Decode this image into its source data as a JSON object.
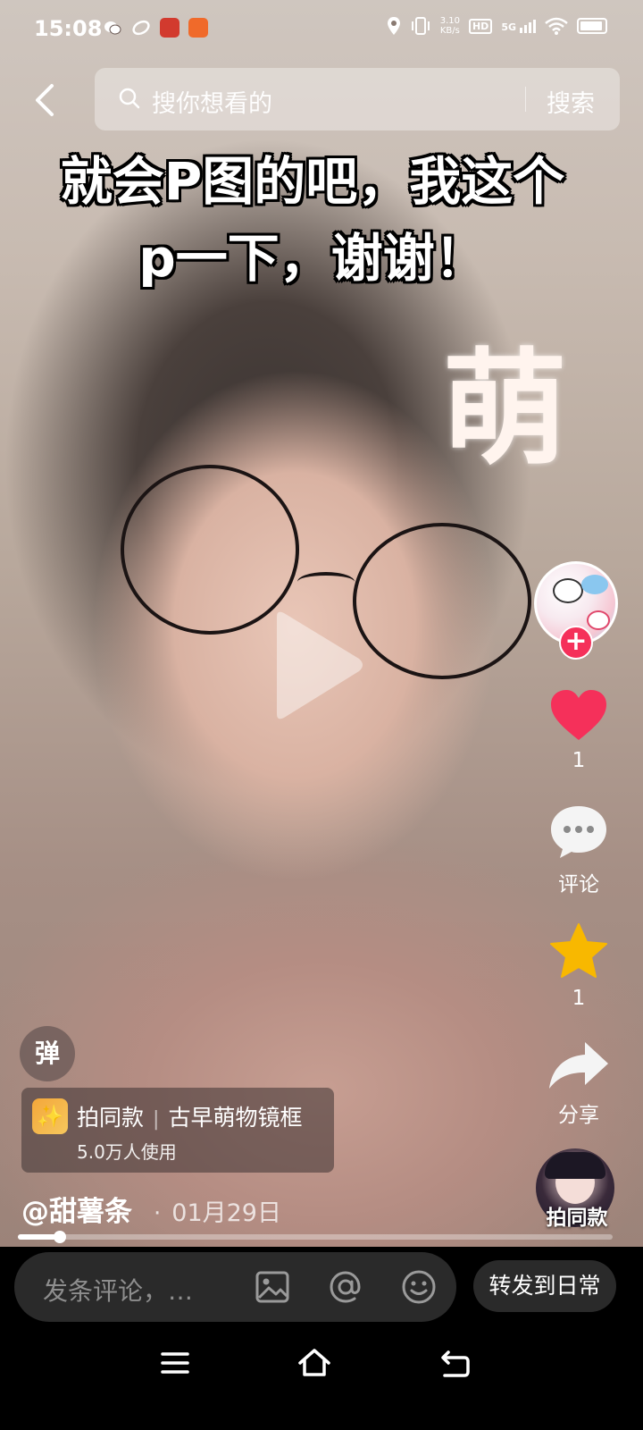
{
  "status_bar": {
    "time": "15:08",
    "net_speed_top": "3.10",
    "net_speed_unit": "KB/s",
    "hd_label": "HD",
    "signal_label": "5G"
  },
  "search": {
    "placeholder": "搜你想看的",
    "button_label": "搜索"
  },
  "caption": {
    "line1": "就会P图的吧，我这个",
    "line2": "p一下，谢谢！"
  },
  "sticker_text": "萌",
  "rail": {
    "like_count": "1",
    "comment_label": "评论",
    "favorite_count": "1",
    "share_label": "分享"
  },
  "danmu_label": "弹",
  "effect": {
    "action_label": "拍同款",
    "name": "古早萌物镜框",
    "usage": "5.0万人使用"
  },
  "author": {
    "name": "@甜薯条",
    "dot": "·",
    "date": "01月29日"
  },
  "same_style_label": "拍同款",
  "progress": {
    "fraction": 0.07
  },
  "bottom": {
    "comment_placeholder": "发条评论，…",
    "repost_label": "转发到日常"
  },
  "colors": {
    "like": "#f5305a",
    "favorite": "#f8b800",
    "follow": "#f5305a"
  }
}
